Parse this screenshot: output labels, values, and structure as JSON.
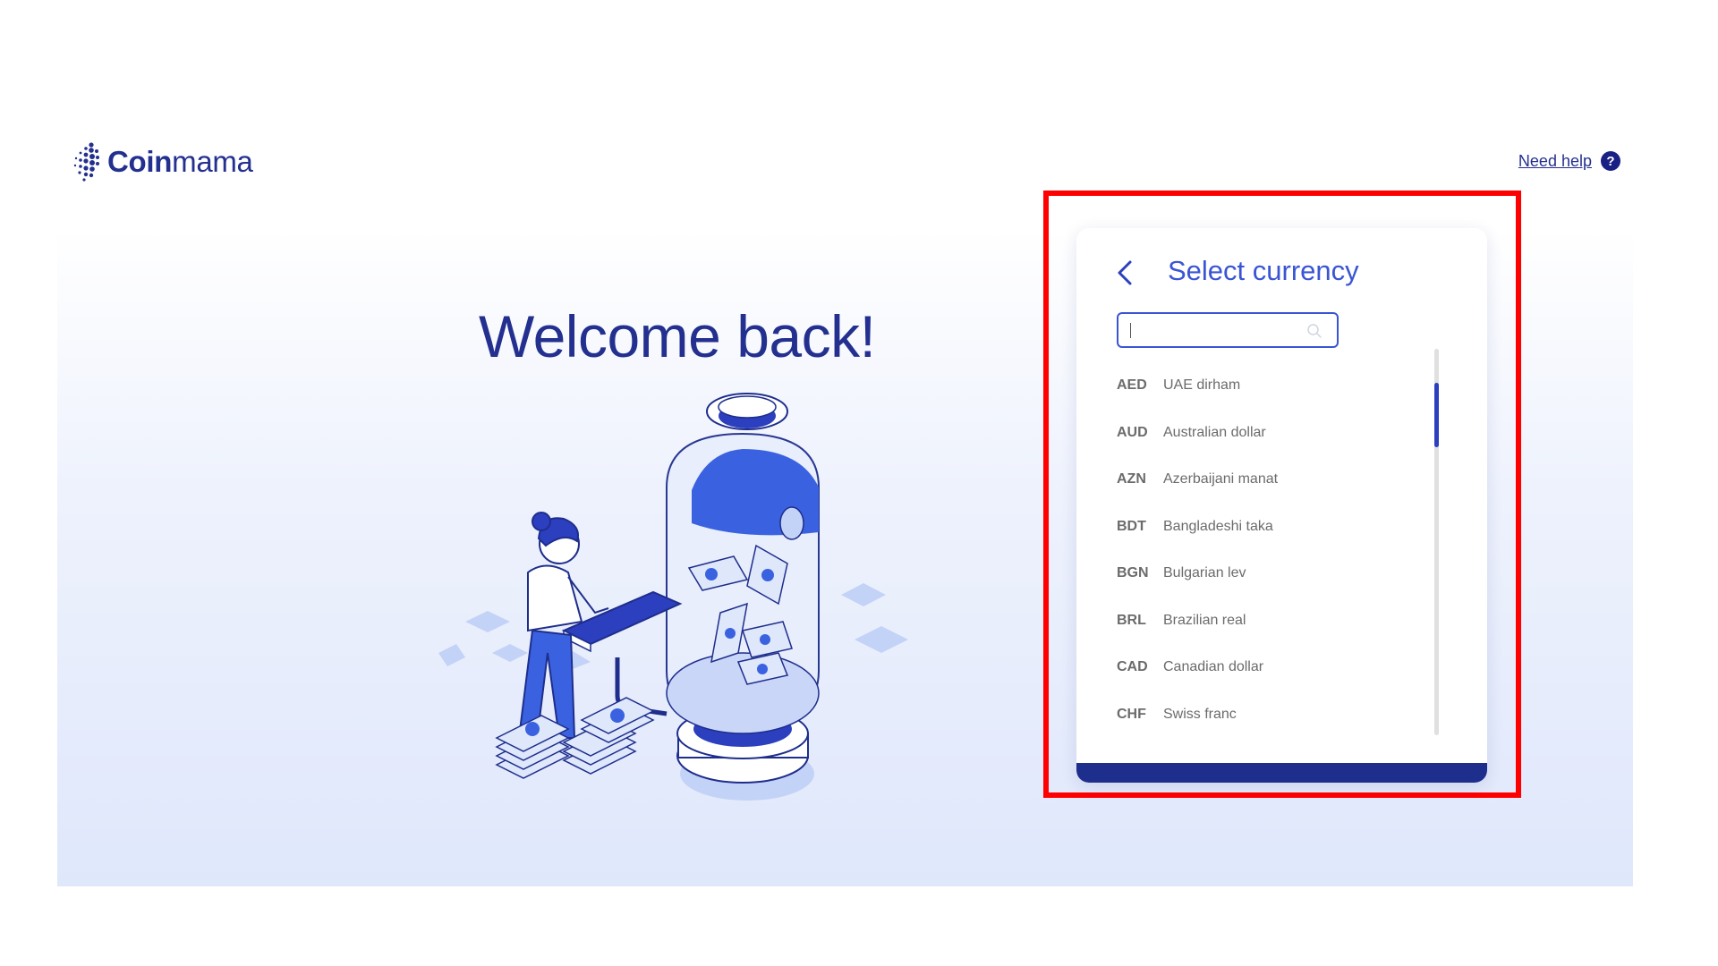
{
  "header": {
    "logo_bold": "Coin",
    "logo_light": "mama",
    "help_label": "Need help",
    "help_icon_glyph": "?"
  },
  "hero": {
    "title": "Welcome back!"
  },
  "currency_panel": {
    "title": "Select currency",
    "search_value": "",
    "items": [
      {
        "code": "AED",
        "name": "UAE dirham"
      },
      {
        "code": "AUD",
        "name": "Australian dollar"
      },
      {
        "code": "AZN",
        "name": "Azerbaijani manat"
      },
      {
        "code": "BDT",
        "name": "Bangladeshi taka"
      },
      {
        "code": "BGN",
        "name": "Bulgarian lev"
      },
      {
        "code": "BRL",
        "name": "Brazilian real"
      },
      {
        "code": "CAD",
        "name": "Canadian dollar"
      },
      {
        "code": "CHF",
        "name": "Swiss franc"
      }
    ]
  },
  "icons": {
    "back": "chevron-left-icon",
    "search": "search-icon",
    "help": "question-icon"
  },
  "colors": {
    "brand_dark": "#23308f",
    "accent_blue": "#3a55d4",
    "footer_blue": "#1e2e8c",
    "highlight_red": "#ff0000"
  }
}
